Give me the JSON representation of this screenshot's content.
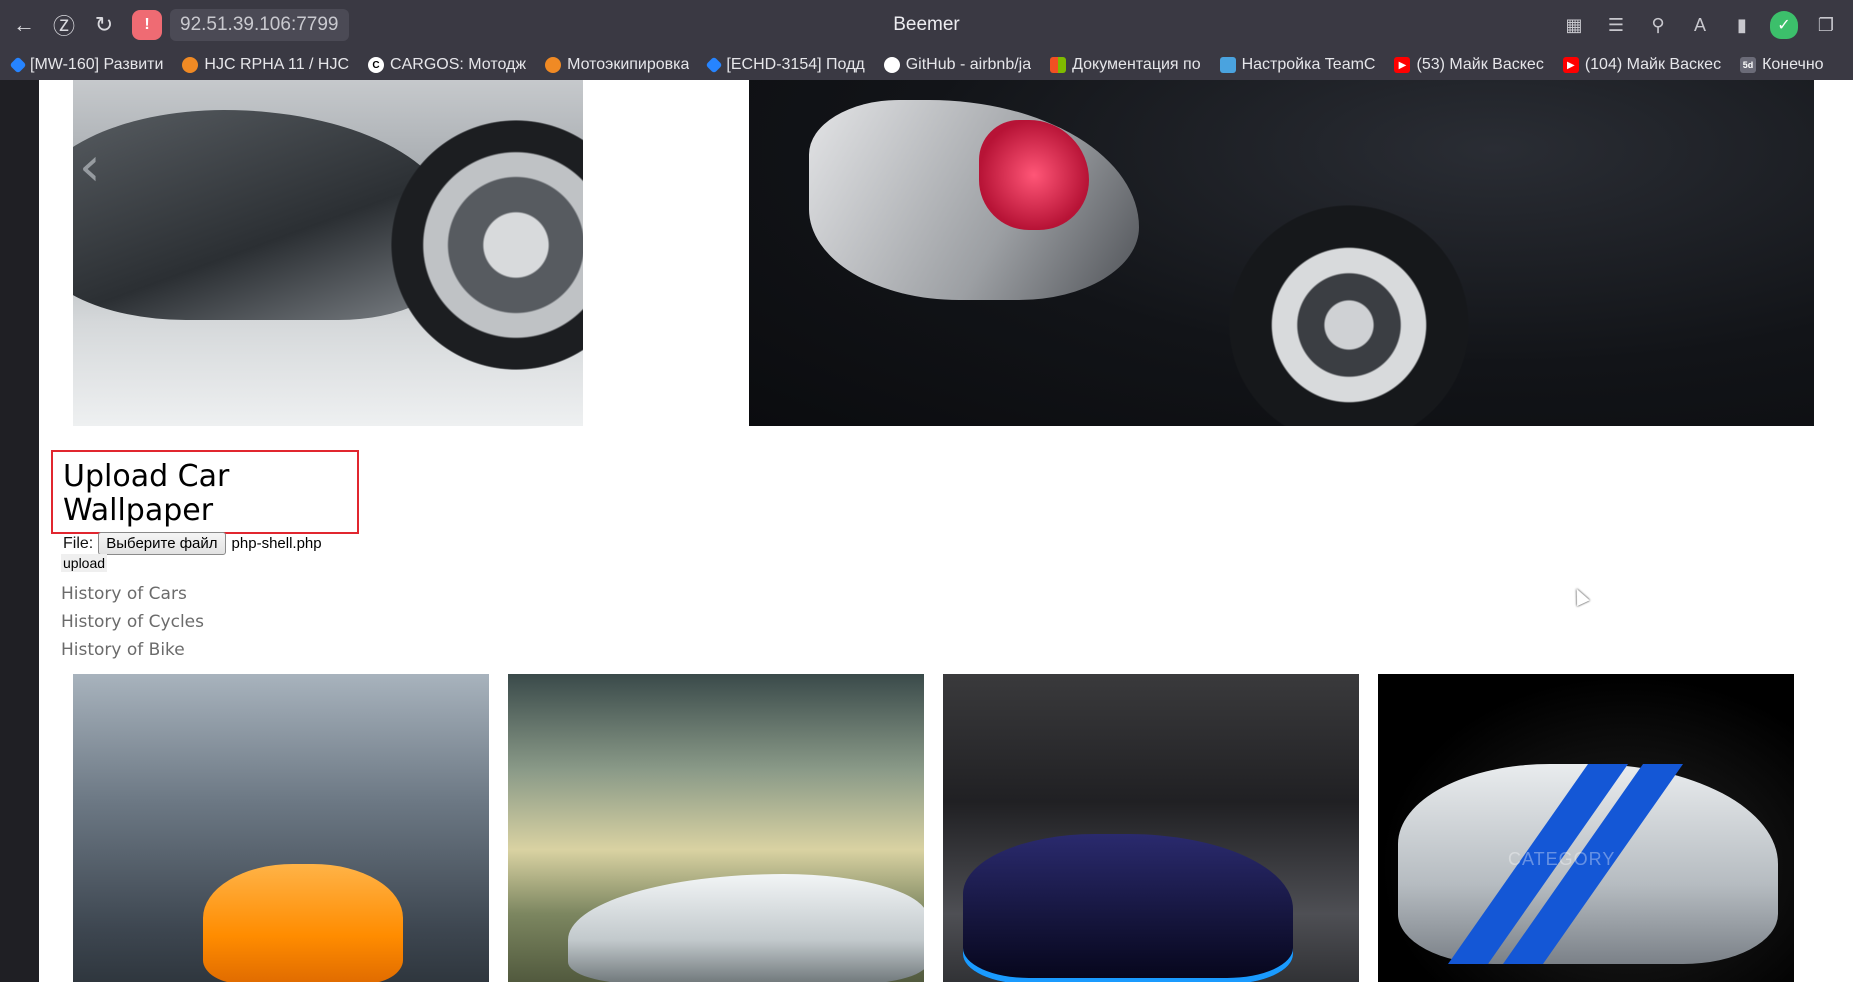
{
  "browser": {
    "title": "Beemer",
    "address": "92.51.39.106:7799",
    "toolbar_icons": [
      "apps-icon",
      "reader-icon",
      "search-icon",
      "translate-icon",
      "bookmark-icon",
      "shield-icon",
      "extensions-icon"
    ]
  },
  "bookmarks": [
    {
      "label": "[MW-160] Развити",
      "icon": "jira-icon",
      "color": "#2684ff"
    },
    {
      "label": "HJC RPHA 11 / HJC",
      "icon": "moto-icon",
      "color": "#f08a24"
    },
    {
      "label": "CARGOS: Мотодж",
      "icon": "c-icon",
      "color": "#ffffff"
    },
    {
      "label": "Мотоэкипировка",
      "icon": "moto-icon",
      "color": "#f08a24"
    },
    {
      "label": "[ECHD-3154] Подд",
      "icon": "jira-icon",
      "color": "#2684ff"
    },
    {
      "label": "GitHub - airbnb/ja",
      "icon": "github-icon",
      "color": "#ffffff"
    },
    {
      "label": "Документация по",
      "icon": "microsoft-icon",
      "color": "#f25022"
    },
    {
      "label": "Настройка TeamC",
      "icon": "teamcity-icon",
      "color": "#4aa3df"
    },
    {
      "label": "(53) Майк Васкес",
      "icon": "youtube-icon",
      "color": "#ff0000"
    },
    {
      "label": "(104) Майк Васкес",
      "icon": "youtube-icon",
      "color": "#ff0000"
    },
    {
      "label": "Конечно",
      "icon": "5d-icon",
      "color": "#6b6b78"
    }
  ],
  "upload": {
    "title": "Upload Car Wallpaper",
    "file_label": "File:",
    "choose_button": "Выберите файл",
    "file_name": "php-shell.php",
    "submit_label": "upload"
  },
  "links": [
    "History of Cars",
    "History of Cycles",
    "History of Bike"
  ],
  "gallery_overlay": "CATEGORY"
}
